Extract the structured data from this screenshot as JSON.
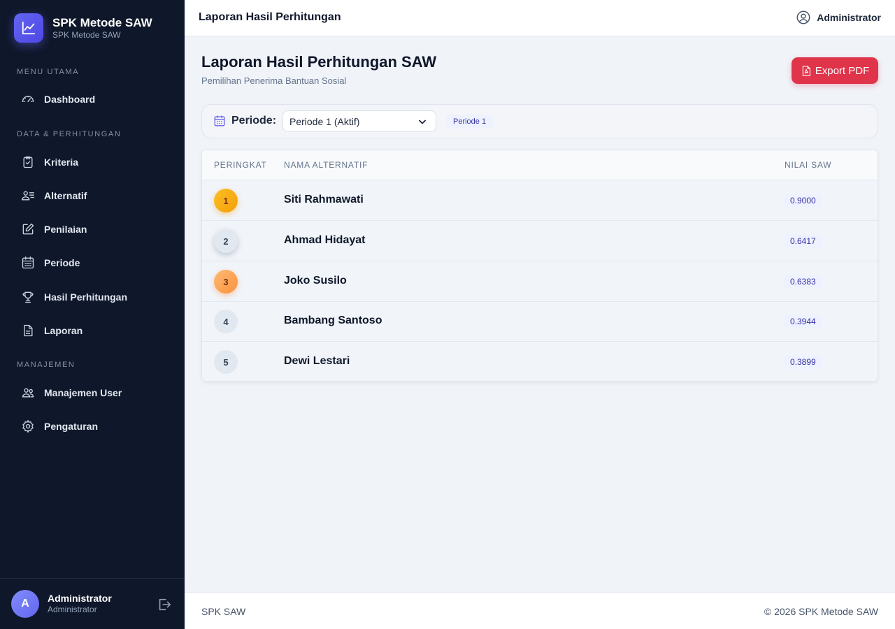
{
  "app": {
    "title": "SPK Metode SAW",
    "subtitle": "SPK Metode SAW"
  },
  "sidebar": {
    "sections": [
      "MENU UTAMA",
      "DATA & PERHITUNGAN",
      "MANAJEMEN"
    ],
    "items": [
      {
        "label": "Dashboard",
        "icon": "gauge-icon"
      },
      {
        "label": "Kriteria",
        "icon": "clipboard-check-icon"
      },
      {
        "label": "Alternatif",
        "icon": "users-list-icon"
      },
      {
        "label": "Penilaian",
        "icon": "edit-icon"
      },
      {
        "label": "Periode",
        "icon": "calendar-icon"
      },
      {
        "label": "Hasil Perhitungan",
        "icon": "trophy-icon"
      },
      {
        "label": "Laporan",
        "icon": "document-icon"
      },
      {
        "label": "Manajemen User",
        "icon": "users-icon"
      },
      {
        "label": "Pengaturan",
        "icon": "gear-icon"
      }
    ],
    "user": {
      "initial": "A",
      "name": "Administrator",
      "role": "Administrator"
    }
  },
  "topbar": {
    "title": "Laporan Hasil Perhitungan",
    "user": "Administrator"
  },
  "main": {
    "title": "Laporan Hasil Perhitungan SAW",
    "subtitle": "Pemilihan Penerima Bantuan Sosial",
    "export_label": "Export PDF",
    "filter": {
      "label": "Periode:",
      "selected": "Periode 1 (Aktif)",
      "chip": "Periode 1"
    },
    "table": {
      "headers": [
        "PERINGKAT",
        "NAMA ALTERNATIF",
        "NILAI SAW"
      ],
      "rows": [
        {
          "rank": "1",
          "name": "Siti Rahmawati",
          "score": "0.9000"
        },
        {
          "rank": "2",
          "name": "Ahmad Hidayat",
          "score": "0.6417"
        },
        {
          "rank": "3",
          "name": "Joko Susilo",
          "score": "0.6383"
        },
        {
          "rank": "4",
          "name": "Bambang Santoso",
          "score": "0.3944"
        },
        {
          "rank": "5",
          "name": "Dewi Lestari",
          "score": "0.3899"
        }
      ]
    }
  },
  "footer": {
    "left": "SPK SAW",
    "right": "© 2026 SPK Metode SAW"
  },
  "colors": {
    "sidebar_bg": "#0f172a",
    "accent": "#4f46e5",
    "export_button": "#e0344a",
    "gold": "#f59e0b",
    "bronze": "#fb923c"
  }
}
